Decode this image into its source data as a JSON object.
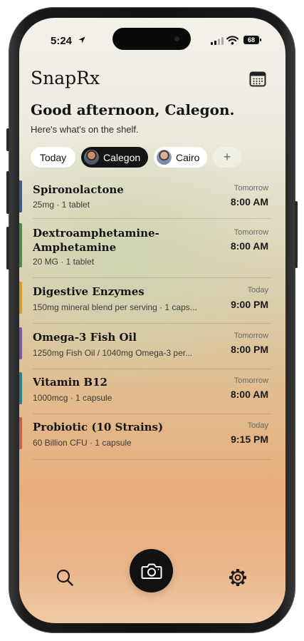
{
  "status_bar": {
    "time": "5:24",
    "battery": "68"
  },
  "header": {
    "app_title": "SnapRx",
    "greeting": "Good afternoon, Calegon.",
    "subtitle": "Here's what's on the shelf."
  },
  "filters": {
    "today": "Today",
    "people": [
      {
        "name": "Calegon",
        "selected": true
      },
      {
        "name": "Cairo",
        "selected": false
      }
    ],
    "add": "+"
  },
  "medications": [
    {
      "name_lines": [
        "Spironolactone"
      ],
      "dose": "25mg · 1 tablet",
      "day": "Tomorrow",
      "time": "8:00 AM",
      "color": "#3f5c84"
    },
    {
      "name_lines": [
        "Dextroamphetamine-",
        "Amphetamine"
      ],
      "dose": "20 MG · 1 tablet",
      "day": "Tomorrow",
      "time": "8:00 AM",
      "color": "#4f8a46"
    },
    {
      "name_lines": [
        "Digestive Enzymes"
      ],
      "dose": "150mg mineral blend per serving · 1 caps...",
      "day": "Today",
      "time": "9:00 PM",
      "color": "#d09a2e"
    },
    {
      "name_lines": [
        "Omega-3 Fish Oil"
      ],
      "dose": "1250mg Fish Oil / 1040mg Omega-3 per...",
      "day": "Tomorrow",
      "time": "8:00 PM",
      "color": "#7a5a9a"
    },
    {
      "name_lines": [
        "Vitamin B12"
      ],
      "dose": "1000mcg · 1 capsule",
      "day": "Tomorrow",
      "time": "8:00 AM",
      "color": "#2e7f84"
    },
    {
      "name_lines": [
        "Probiotic (10 Strains)"
      ],
      "dose": "60 Billion CFU · 1 capsule",
      "day": "Today",
      "time": "9:15 PM",
      "color": "#c4644a"
    }
  ],
  "icons": {
    "calendar": "calendar-icon",
    "search": "search-icon",
    "camera": "camera-icon",
    "settings": "gear-icon",
    "location": "location-arrow-icon",
    "signal": "cellular-signal-icon",
    "wifi": "wifi-icon"
  }
}
